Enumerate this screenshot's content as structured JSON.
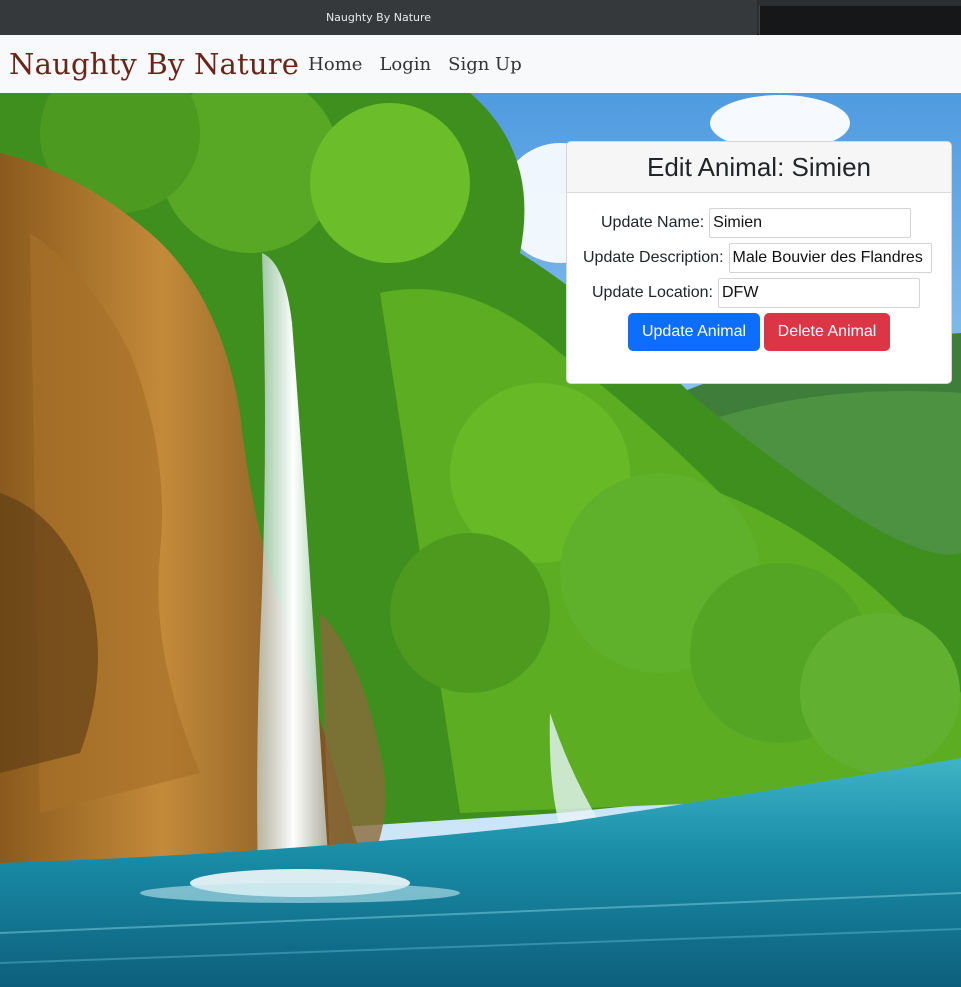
{
  "window": {
    "title": "Naughty By Nature"
  },
  "navbar": {
    "brand": "Naughty By Nature",
    "links": [
      "Home",
      "Login",
      "Sign Up"
    ]
  },
  "card": {
    "title": "Edit Animal: Simien",
    "fields": [
      {
        "label": "Update Name:",
        "value": "Simien"
      },
      {
        "label": "Update Description:",
        "value": "Male Bouvier des Flandres"
      },
      {
        "label": "Update Location:",
        "value": "DFW"
      }
    ],
    "update_label": "Update Animal",
    "delete_label": "Delete Animal"
  },
  "colors": {
    "brand": "#6b2418",
    "primary": "#0d6efd",
    "danger": "#dc3545",
    "navbar_bg": "#f8f9fa"
  }
}
